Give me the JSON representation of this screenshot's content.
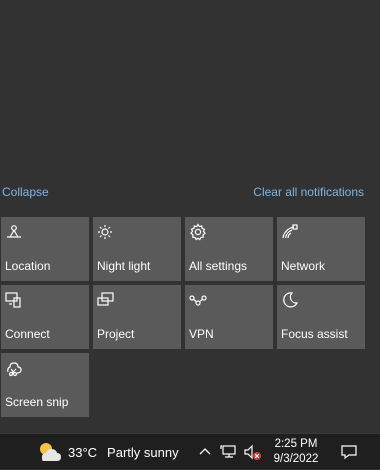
{
  "action_center": {
    "collapse_label": "Collapse",
    "clear_label": "Clear all notifications",
    "accent_color": "#7fb5e6",
    "tile_color": "#5a5a5a",
    "tiles": [
      {
        "label": "Location",
        "icon": "location-icon"
      },
      {
        "label": "Night light",
        "icon": "night-light-icon"
      },
      {
        "label": "All settings",
        "icon": "gear-icon"
      },
      {
        "label": "Network",
        "icon": "network-icon"
      },
      {
        "label": "Connect",
        "icon": "connect-icon"
      },
      {
        "label": "Project",
        "icon": "project-icon"
      },
      {
        "label": "VPN",
        "icon": "vpn-icon"
      },
      {
        "label": "Focus assist",
        "icon": "moon-icon"
      },
      {
        "label": "Screen snip",
        "icon": "screen-snip-icon"
      }
    ]
  },
  "taskbar": {
    "weather": {
      "temp": "33°C",
      "condition": "Partly sunny",
      "icon": "partly-sunny-icon"
    },
    "tray_icons": [
      "chevron-up-icon",
      "network-icon",
      "volume-muted-icon",
      "notification-icon"
    ],
    "time": "2:25 PM",
    "date": "9/3/2022"
  }
}
